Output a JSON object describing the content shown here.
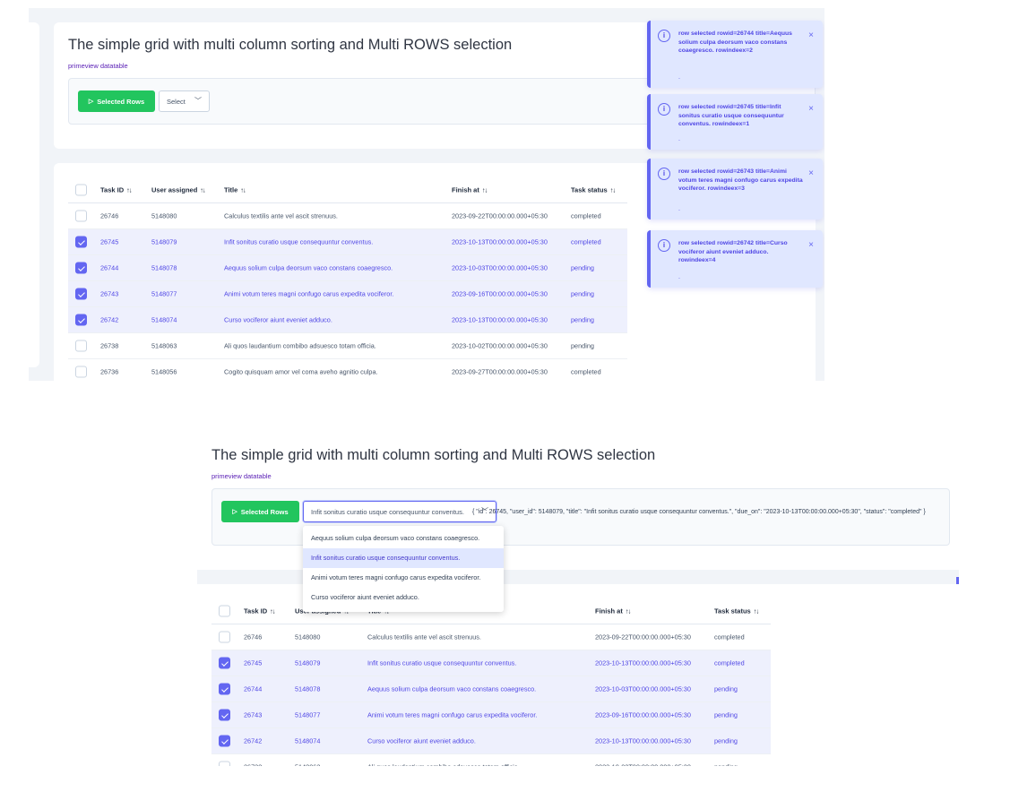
{
  "page": {
    "title": "The simple grid with multi column sorting and Multi ROWS selection",
    "subtitle": "primeview datatable"
  },
  "toolbar": {
    "selected_rows_label": "Selected Rows",
    "select_placeholder": "Select",
    "select_value_open": "Infit sonitus curatio usque consequuntur conventus.",
    "json_output": "{ \"id\": 26745, \"user_id\": 5148079, \"title\": \"Infit sonitus curatio usque consequuntur conventus.\", \"due_on\": \"2023-10-13T00:00:00.000+05:30\", \"status\": \"completed\" }"
  },
  "dropdown": {
    "options": [
      "Aequus solium culpa deorsum vaco constans coaegresco.",
      "Infit sonitus curatio usque consequuntur conventus.",
      "Animi votum teres magni confugo carus expedita vociferor.",
      "Curso vociferor aiunt eveniet adduco."
    ],
    "active_index": 1
  },
  "table": {
    "columns": {
      "task_id": "Task ID",
      "user": "User assigned",
      "title": "Title",
      "finish": "Finish at",
      "status": "Task status"
    },
    "sort_icon": "↑↓",
    "rows": [
      {
        "id": "26746",
        "user": "5148080",
        "title": "Calculus textilis ante vel ascit strenuus.",
        "finish": "2023-09-22T00:00:00.000+05:30",
        "status": "completed",
        "selected": false
      },
      {
        "id": "26745",
        "user": "5148079",
        "title": "Infit sonitus curatio usque consequuntur conventus.",
        "finish": "2023-10-13T00:00:00.000+05:30",
        "status": "completed",
        "selected": true
      },
      {
        "id": "26744",
        "user": "5148078",
        "title": "Aequus solium culpa deorsum vaco constans coaegresco.",
        "finish": "2023-10-03T00:00:00.000+05:30",
        "status": "pending",
        "selected": true
      },
      {
        "id": "26743",
        "user": "5148077",
        "title": "Animi votum teres magni confugo carus expedita vociferor.",
        "finish": "2023-09-16T00:00:00.000+05:30",
        "status": "pending",
        "selected": true
      },
      {
        "id": "26742",
        "user": "5148074",
        "title": "Curso vociferor aiunt eveniet adduco.",
        "finish": "2023-10-13T00:00:00.000+05:30",
        "status": "pending",
        "selected": true
      },
      {
        "id": "26738",
        "user": "5148063",
        "title": "Ali quos laudantium combibo adsuesco totam officia.",
        "finish": "2023-10-02T00:00:00.000+05:30",
        "status": "pending",
        "selected": false
      },
      {
        "id": "26736",
        "user": "5148056",
        "title": "Cogito quisquam amor vel coma aveho agnitio culpa.",
        "finish": "2023-09-27T00:00:00.000+05:30",
        "status": "completed",
        "selected": false
      }
    ]
  },
  "toasts": [
    {
      "message": "row selected rowid=26744 title=Aequus solium culpa deorsum vaco constans coaegresco. rowindeex=2",
      "icon": "info-icon",
      "close": "×",
      "dot": "."
    },
    {
      "message": "row selected rowid=26745 title=Infit sonitus curatio usque consequuntur conventus. rowindeex=1",
      "icon": "info-icon",
      "close": "×",
      "dot": "."
    },
    {
      "message": "row selected rowid=26743 title=Animi votum teres magni confugo carus expedita vociferor. rowindeex=3",
      "icon": "info-icon",
      "close": "×",
      "dot": "."
    },
    {
      "message": "row selected rowid=26742 title=Curso vociferor aiunt eveniet adduco. rowindeex=4",
      "icon": "info-icon",
      "close": "×",
      "dot": "."
    }
  ],
  "colors": {
    "accent": "#6366f1",
    "button_green": "#22c55e",
    "selected_row_bg": "#eef0fd",
    "toast_bg": "#e0e7ff"
  }
}
